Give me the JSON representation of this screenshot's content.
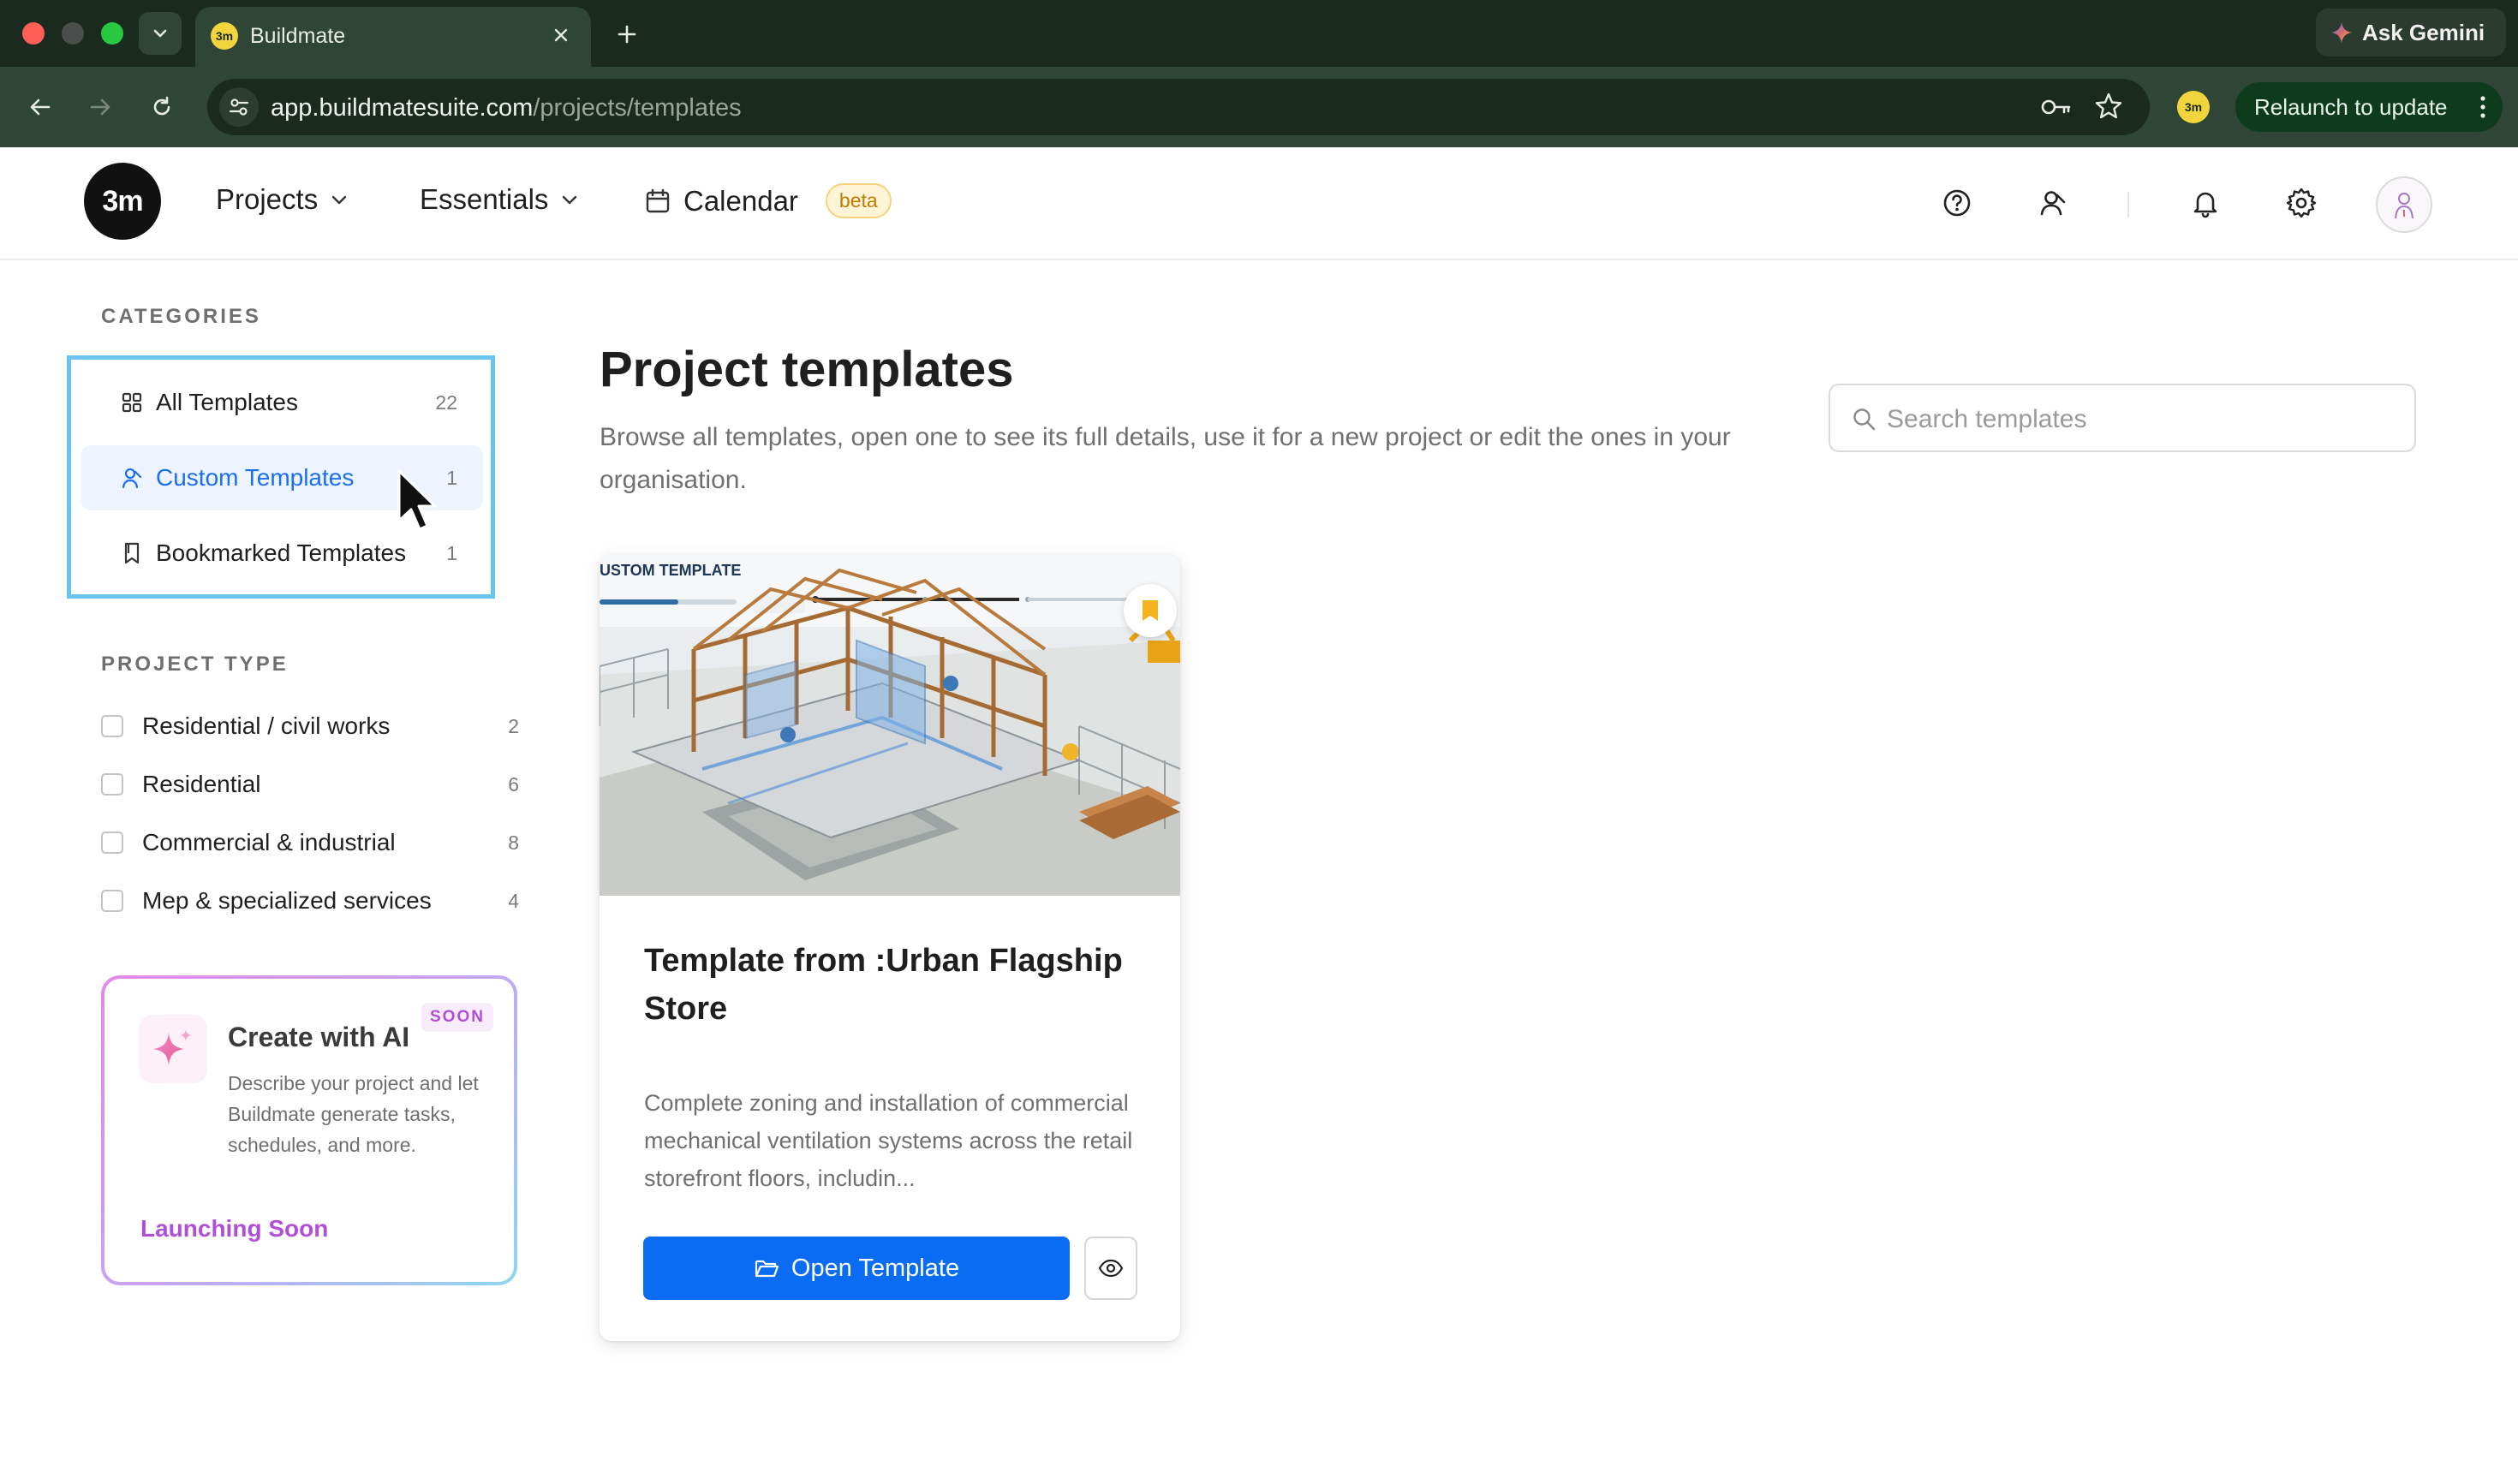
{
  "browser": {
    "tab_title": "Buildmate",
    "tab_favicon": "3m",
    "url_host": "app.buildmatesuite.com",
    "url_path": "/projects/templates",
    "ask_gemini": "Ask Gemini",
    "profile_badge": "3m",
    "relaunch_label": "Relaunch to update"
  },
  "header": {
    "logo_text": "3m",
    "nav_projects": "Projects",
    "nav_essentials": "Essentials",
    "nav_calendar": "Calendar",
    "calendar_badge": "beta"
  },
  "sidebar": {
    "categories_title": "CATEGORIES",
    "categories": [
      {
        "label": "All Templates",
        "count": "22",
        "icon": "grid-icon"
      },
      {
        "label": "Custom Templates",
        "count": "1",
        "icon": "user-icon",
        "active": true
      },
      {
        "label": "Bookmarked Templates",
        "count": "1",
        "icon": "bookmark-icon"
      }
    ],
    "project_type_title": "PROJECT TYPE",
    "project_types": [
      {
        "label": "Residential / civil works",
        "count": "2",
        "checked": false
      },
      {
        "label": "Residential",
        "count": "6",
        "checked": false
      },
      {
        "label": "Commercial & industrial",
        "count": "8",
        "checked": false
      },
      {
        "label": "Mep & specialized services",
        "count": "4",
        "checked": false
      }
    ],
    "ai_card": {
      "title": "Create with AI",
      "badge": "SOON",
      "description": "Describe your project and let Buildmate generate tasks, schedules, and more.",
      "link": "Launching Soon"
    }
  },
  "main": {
    "title": "Project templates",
    "description": "Browse all templates, open one to see its full details, use it for a new project or edit the ones in your organisation.",
    "search_placeholder": "Search templates",
    "card": {
      "image_caption": "USTOM TEMPLATE",
      "title": "Template from :Urban Flagship Store",
      "description": "Complete zoning and installation of commercial mechanical ventilation systems across the retail storefront floors, includin...",
      "open_label": "Open Template"
    }
  },
  "colors": {
    "accent_blue": "#0a6cf2",
    "active_bg": "#eef4ff",
    "selection_outline": "#69c4ef",
    "ai_purple": "#b24fd8",
    "beta_orange": "#c07a00",
    "chrome_dark": "#1b2a1f",
    "relaunch_green": "#0e3b1c"
  }
}
